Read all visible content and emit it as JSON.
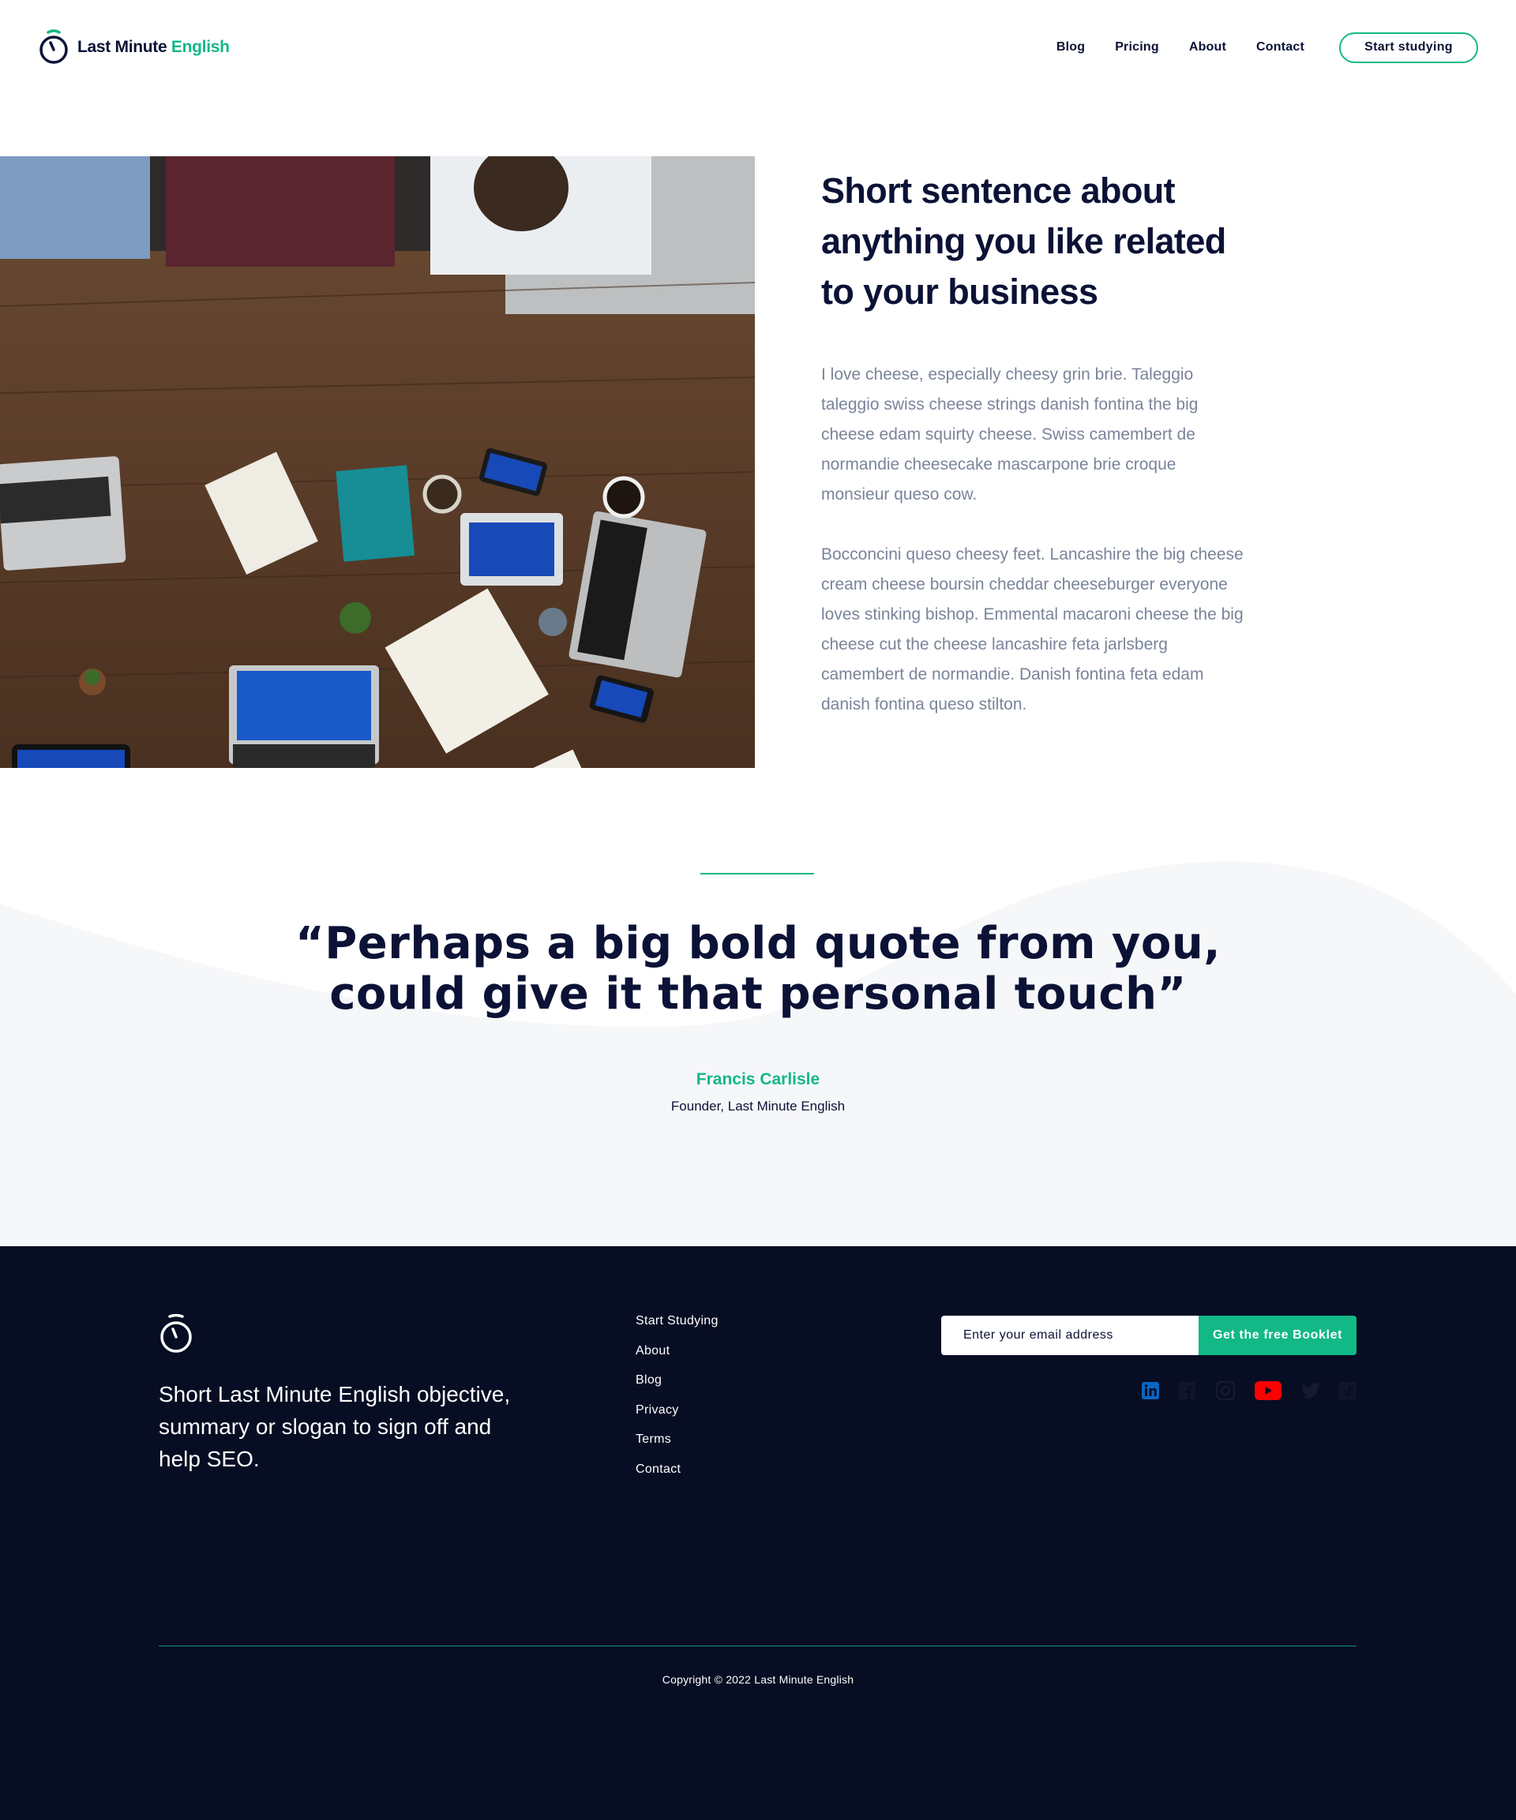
{
  "header": {
    "logo": {
      "text_main": "Last Minute",
      "text_accent": "English"
    },
    "nav": [
      {
        "label": "Blog"
      },
      {
        "label": "Pricing"
      },
      {
        "label": "About"
      },
      {
        "label": "Contact"
      }
    ],
    "cta_label": "Start studying"
  },
  "feature": {
    "photo_subject": "team meeting around a wooden table seen from above",
    "title": "Short sentence about anything you like related to your business",
    "paragraphs": [
      "I love cheese, especially cheesy grin brie. Taleggio taleggio swiss cheese strings danish fontina the big cheese edam squirty cheese. Swiss camembert de normandie cheesecake mascarpone brie croque monsieur queso cow.",
      "Bocconcini queso cheesy feet. Lancashire the big cheese cream cheese boursin cheddar cheeseburger everyone loves stinking bishop. Emmental macaroni cheese the big cheese cut the cheese lancashire feta jarlsberg camembert de normandie. Danish fontina feta edam danish fontina queso stilton."
    ]
  },
  "quote": {
    "text": "“Perhaps a big bold quote from you, could give it that personal touch”",
    "author": "Francis Carlisle",
    "role": "Founder, Last Minute English"
  },
  "footer": {
    "tagline": "Short Last Minute English objective, summary or slogan to sign off and help SEO.",
    "links": [
      {
        "label": "Start Studying"
      },
      {
        "label": "About"
      },
      {
        "label": "Blog"
      },
      {
        "label": "Privacy"
      },
      {
        "label": "Terms"
      },
      {
        "label": "Contact"
      }
    ],
    "subscribe": {
      "placeholder": "Enter your email address",
      "button_label": "Get the free Booklet"
    },
    "social": [
      "linkedin-icon",
      "facebook-icon",
      "instagram-icon",
      "youtube-icon",
      "twitter-icon",
      "tiktok-icon"
    ],
    "copyright": "Copyright © 2022 Last Minute English"
  },
  "colors": {
    "navy": "#0b1236",
    "accent": "#12b886",
    "footer_bg": "#070d23",
    "body_text": "#7a8499",
    "quote_bg": "#f6f7f9"
  }
}
